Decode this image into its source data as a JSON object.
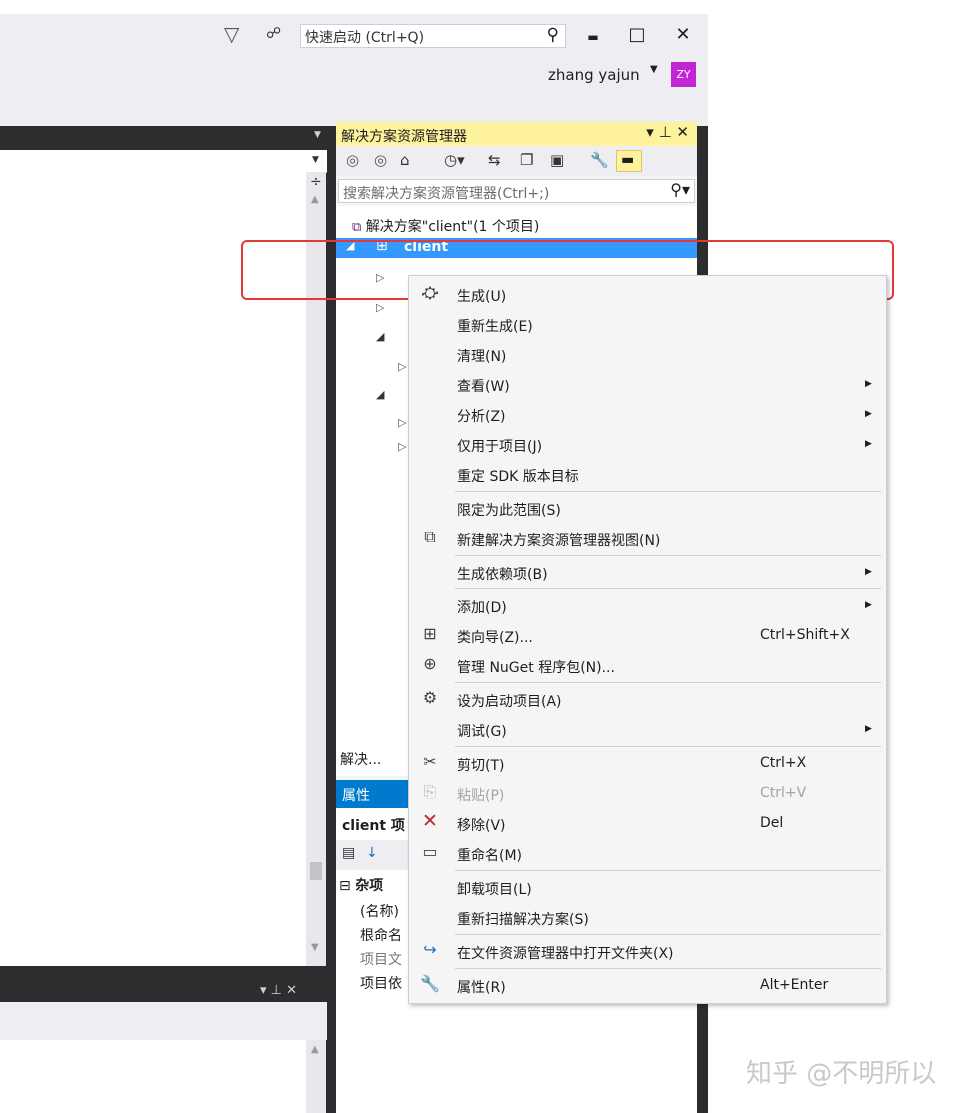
{
  "titlebar": {
    "quick_launch": "快速启动 (Ctrl+Q)",
    "minimize": "▬",
    "maximize": "□",
    "close": "✕",
    "user_name": "zhang yajun",
    "avatar_initials": "ZY",
    "avatar_color": "#c026d3"
  },
  "solution_explorer": {
    "title": "解决方案资源管理器",
    "title_buttons": "▾ ⊥ ✕",
    "search_placeholder": "搜索解决方案资源管理器(Ctrl+;)",
    "solution_node": "解决方案\"client\"(1 个项目)",
    "project_node": "client",
    "footer_tab": "解决..."
  },
  "properties": {
    "title": "属性",
    "object": "client 项",
    "category": "杂项",
    "rows": [
      "(名称)",
      "根命名",
      "项目文",
      "项目依"
    ]
  },
  "context_menu": {
    "items": [
      {
        "label": "生成(U)",
        "icon": "build-icon"
      },
      {
        "label": "重新生成(E)"
      },
      {
        "label": "清理(N)"
      },
      {
        "label": "查看(W)",
        "submenu": true
      },
      {
        "label": "分析(Z)",
        "submenu": true
      },
      {
        "label": "仅用于项目(J)",
        "submenu": true
      },
      {
        "label": "重定 SDK 版本目标"
      },
      {
        "label": "限定为此范围(S)"
      },
      {
        "label": "新建解决方案资源管理器视图(N)",
        "icon": "new-view-icon"
      },
      {
        "label": "生成依赖项(B)",
        "submenu": true
      },
      {
        "label": "添加(D)",
        "submenu": true
      },
      {
        "label": "类向导(Z)...",
        "shortcut": "Ctrl+Shift+X",
        "icon": "class-wizard-icon"
      },
      {
        "label": "管理 NuGet 程序包(N)...",
        "icon": "nuget-icon"
      },
      {
        "label": "设为启动项目(A)",
        "icon": "gear-icon"
      },
      {
        "label": "调试(G)",
        "submenu": true
      },
      {
        "label": "剪切(T)",
        "shortcut": "Ctrl+X",
        "icon": "scissors-icon"
      },
      {
        "label": "粘贴(P)",
        "shortcut": "Ctrl+V",
        "icon": "paste-icon",
        "disabled": true
      },
      {
        "label": "移除(V)",
        "shortcut": "Del",
        "icon": "remove-icon"
      },
      {
        "label": "重命名(M)",
        "icon": "rename-icon"
      },
      {
        "label": "卸载项目(L)"
      },
      {
        "label": "重新扫描解决方案(S)"
      },
      {
        "label": "在文件资源管理器中打开文件夹(X)",
        "icon": "open-folder-icon"
      },
      {
        "label": "属性(R)",
        "shortcut": "Alt+Enter",
        "icon": "wrench-icon"
      }
    ]
  },
  "watermark": "知乎 @不明所以",
  "colors": {
    "highlight": "#e53935",
    "selection": "#3399ff",
    "title_active": "#fff29d",
    "accent": "#007acc"
  }
}
